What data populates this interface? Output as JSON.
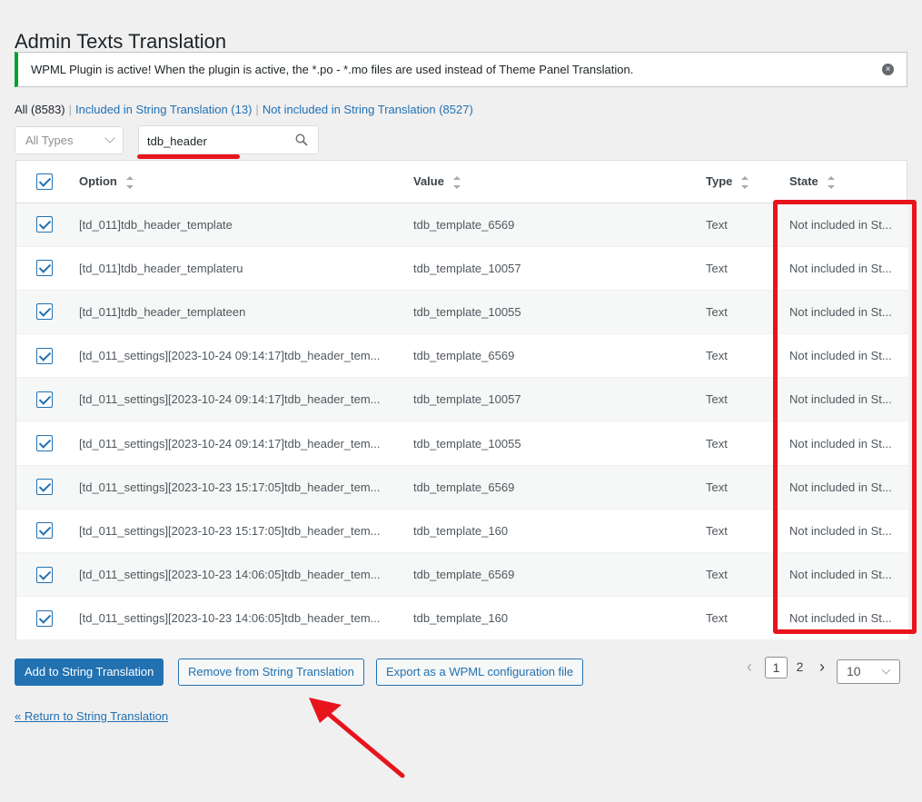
{
  "page_title": "Admin Texts Translation",
  "notice": {
    "text": "WPML Plugin is active! When the plugin is active, the *.po - *.mo files are used instead of Theme Panel Translation.",
    "close_glyph": "×"
  },
  "filters": {
    "all": "All (8583)",
    "sep": "|",
    "included": "Included in String Translation (13)",
    "not_included": "Not included in String Translation (8527)"
  },
  "type_filter": {
    "selected": "All Types"
  },
  "search": {
    "value": "tdb_header"
  },
  "table": {
    "headers": {
      "option": "Option",
      "value": "Value",
      "type": "Type",
      "state": "State"
    },
    "rows": [
      {
        "option": "[td_011]tdb_header_template",
        "value": "tdb_template_6569",
        "type": "Text",
        "state": "Not included in St..."
      },
      {
        "option": "[td_011]tdb_header_templateru",
        "value": "tdb_template_10057",
        "type": "Text",
        "state": "Not included in St..."
      },
      {
        "option": "[td_011]tdb_header_templateen",
        "value": "tdb_template_10055",
        "type": "Text",
        "state": "Not included in St..."
      },
      {
        "option": "[td_011_settings][2023-10-24 09:14:17]tdb_header_tem...",
        "value": "tdb_template_6569",
        "type": "Text",
        "state": "Not included in St..."
      },
      {
        "option": "[td_011_settings][2023-10-24 09:14:17]tdb_header_tem...",
        "value": "tdb_template_10057",
        "type": "Text",
        "state": "Not included in St..."
      },
      {
        "option": "[td_011_settings][2023-10-24 09:14:17]tdb_header_tem...",
        "value": "tdb_template_10055",
        "type": "Text",
        "state": "Not included in St..."
      },
      {
        "option": "[td_011_settings][2023-10-23 15:17:05]tdb_header_tem...",
        "value": "tdb_template_6569",
        "type": "Text",
        "state": "Not included in St..."
      },
      {
        "option": "[td_011_settings][2023-10-23 15:17:05]tdb_header_tem...",
        "value": "tdb_template_160",
        "type": "Text",
        "state": "Not included in St..."
      },
      {
        "option": "[td_011_settings][2023-10-23 14:06:05]tdb_header_tem...",
        "value": "tdb_template_6569",
        "type": "Text",
        "state": "Not included in St..."
      },
      {
        "option": "[td_011_settings][2023-10-23 14:06:05]tdb_header_tem...",
        "value": "tdb_template_160",
        "type": "Text",
        "state": "Not included in St..."
      }
    ]
  },
  "actions": {
    "add": "Add to String Translation",
    "remove": "Remove from String Translation",
    "export": "Export as a WPML configuration file"
  },
  "pagination": {
    "prev_glyph": "‹",
    "next_glyph": "›",
    "pages": [
      "1",
      "2"
    ],
    "current_page": "1",
    "per_page": "10"
  },
  "return_link": "« Return to String Translation",
  "colors": {
    "annotation_red": "#e8141c",
    "primary_blue": "#2271b1",
    "notice_green": "#00a32a"
  }
}
